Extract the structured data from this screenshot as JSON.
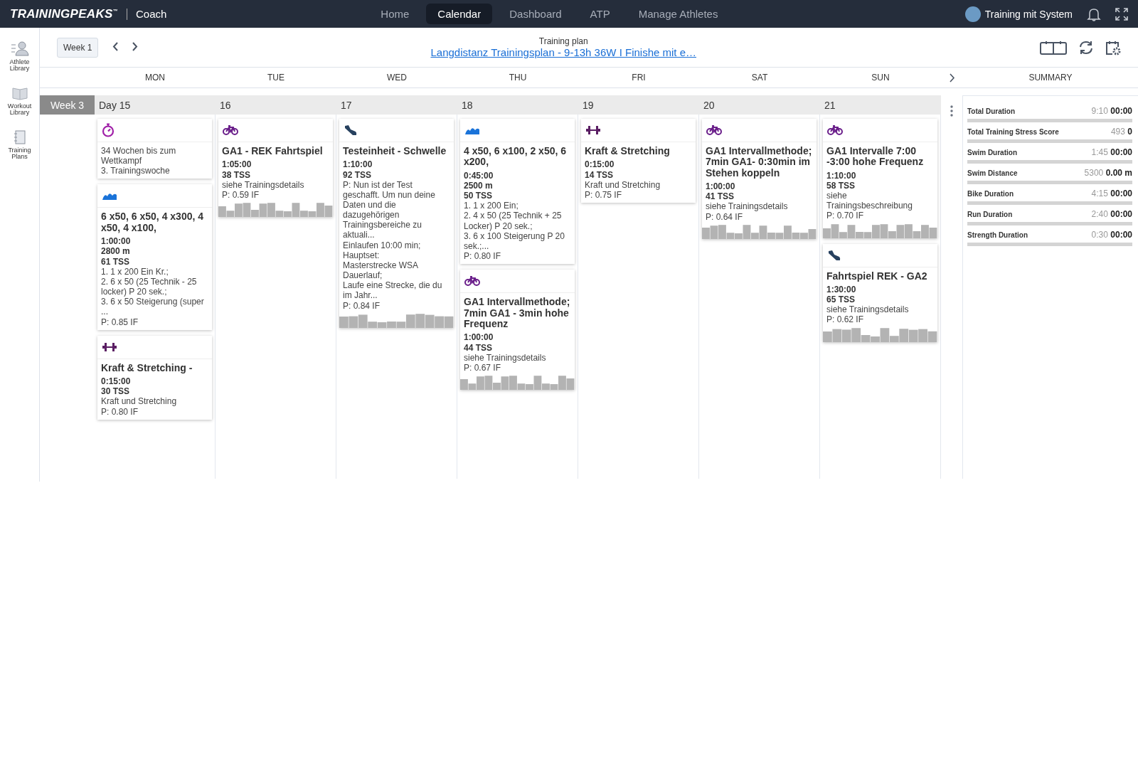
{
  "nav": {
    "logo": "TRAININGPEAKS",
    "logo_mark": "™",
    "product": "Coach",
    "tabs": [
      {
        "label": "Home",
        "selected": false
      },
      {
        "label": "Calendar",
        "selected": true
      },
      {
        "label": "Dashboard",
        "selected": false
      },
      {
        "label": "ATP",
        "selected": false
      },
      {
        "label": "Manage Athletes",
        "selected": false
      }
    ],
    "user": "Training mit System"
  },
  "sidebar": {
    "items": [
      {
        "label": "Athlete Library",
        "kind": "athletes"
      },
      {
        "label": "Workout Library",
        "kind": "book"
      },
      {
        "label": "Training Plans",
        "kind": "plans"
      }
    ]
  },
  "toolbar": {
    "week_button": "Week 1",
    "plan_label": "Training plan",
    "plan_title": "Langdistanz Trainingsplan - 9-13h 36W I Finishe mit e…"
  },
  "day_headers": [
    "MON",
    "TUE",
    "WED",
    "THU",
    "FRI",
    "SAT",
    "SUN"
  ],
  "summary_title": "SUMMARY",
  "week": {
    "label": "Week 3",
    "days": [
      {
        "date": "Day 15",
        "items": [
          {
            "kind": "note",
            "description": "34 Wochen bis zum Wettkampf\n3. Trainingswoche"
          },
          {
            "kind": "swim",
            "title": "6 x50, 6 x50, 4 x300, 4 x50, 4 x100,",
            "lines": [
              "1:00:00",
              "2800 m",
              "61 TSS"
            ],
            "description": "1. 1 x 200 Ein Kr.;\n2. 6 x 50 (25 Technik - 25 locker) P 20 sek.;\n3. 6 x 50 Steigerung (super\n...",
            "intensity": "P: 0.85 IF"
          },
          {
            "kind": "strength",
            "title": "Kraft & Stretching -",
            "lines": [
              "0:15:00",
              "30 TSS"
            ],
            "description": "Kraft und Stretching",
            "intensity": "P: 0.80 IF"
          }
        ]
      },
      {
        "date": "16",
        "items": [
          {
            "kind": "bike",
            "title": "GA1 - REK Fahrtspiel",
            "lines": [
              "1:05:00",
              "38 TSS"
            ],
            "description": "siehe Trainingsdetails",
            "intensity": "P: 0.59 IF"
          }
        ]
      },
      {
        "date": "17",
        "items": [
          {
            "kind": "run",
            "title": "Testeinheit - Schwelle",
            "lines": [
              "1:10:00",
              "92 TSS"
            ],
            "description": "P: Nun ist der Test geschafft. Um nun deine Daten und die dazugehörigen Trainingsbereiche zu aktuali...\nEinlaufen 10:00 min;\nHauptset:\nMasterstrecke WSA Dauerlauf;\nLaufe eine Strecke, die du im Jahr...",
            "intensity": "P: 0.84 IF"
          }
        ]
      },
      {
        "date": "18",
        "items": [
          {
            "kind": "swim",
            "title": "4 x50, 6 x100, 2 x50, 6 x200,",
            "lines": [
              "0:45:00",
              "2500 m",
              "50 TSS"
            ],
            "description": "1. 1 x 200 Ein;\n2. 4 x 50 (25 Technik + 25 Locker) P 20 sek.;\n3. 6 x 100 Steigerung P 20 sek.;...",
            "intensity": "P: 0.80 IF"
          },
          {
            "kind": "bike",
            "title": "GA1 Intervallmethode; 7min GA1 - 3min hohe Frequenz",
            "lines": [
              "1:00:00",
              "44 TSS"
            ],
            "description": "siehe Trainingsdetails",
            "intensity": "P: 0.67 IF"
          }
        ]
      },
      {
        "date": "19",
        "items": [
          {
            "kind": "strength",
            "title": "Kraft & Stretching",
            "lines": [
              "0:15:00",
              "14 TSS"
            ],
            "description": "Kraft und Stretching",
            "intensity": "P: 0.75 IF"
          }
        ]
      },
      {
        "date": "20",
        "items": [
          {
            "kind": "bike",
            "title": "GA1 Intervallmethode; 7min GA1- 0:30min im Stehen koppeln",
            "lines": [
              "1:00:00",
              "41 TSS"
            ],
            "description": "siehe Trainingsdetails",
            "intensity": "P: 0.64 IF"
          }
        ]
      },
      {
        "date": "21",
        "items": [
          {
            "kind": "bike",
            "title": "GA1 Intervalle 7:00 -3:00 hohe Frequenz",
            "lines": [
              "1:10:00",
              "58 TSS"
            ],
            "description": "siehe Trainingsbeschreibung",
            "intensity": "P: 0.70 IF"
          },
          {
            "kind": "run",
            "title": "Fahrtspiel REK - GA2",
            "lines": [
              "1:30:00",
              "65 TSS"
            ],
            "description": "siehe Trainingsdetails",
            "intensity": "P: 0.62 IF"
          }
        ]
      }
    ]
  },
  "summary": [
    {
      "label": "Total Duration",
      "planned": "9:10",
      "completed": "00:00",
      "level": 0
    },
    {
      "label": "Total Training Stress Score",
      "planned": "493",
      "completed": "0",
      "level": 0
    },
    {
      "label": "Swim Duration",
      "planned": "1:45",
      "completed": "00:00",
      "level": 0
    },
    {
      "label": "Swim Distance",
      "planned": "5300",
      "completed": "0.00 m",
      "level": 0
    },
    {
      "label": "Bike Duration",
      "planned": "4:15",
      "completed": "00:00",
      "level": 0
    },
    {
      "label": "Run Duration",
      "planned": "2:40",
      "completed": "00:00",
      "level": 0
    },
    {
      "label": "Strength Duration",
      "planned": "0:30",
      "completed": "00:00",
      "level": 0
    }
  ]
}
